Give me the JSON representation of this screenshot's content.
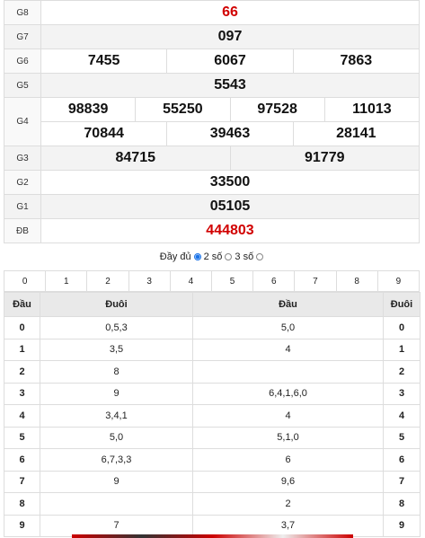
{
  "prizes": {
    "g8": {
      "label": "G8",
      "value": "66"
    },
    "g7": {
      "label": "G7",
      "value": "097"
    },
    "g6": {
      "label": "G6",
      "values": [
        "7455",
        "6067",
        "7863"
      ]
    },
    "g5": {
      "label": "G5",
      "value": "5543"
    },
    "g4": {
      "label": "G4",
      "row1": [
        "98839",
        "55250",
        "97528",
        "11013"
      ],
      "row2": [
        "70844",
        "39463",
        "28141"
      ]
    },
    "g3": {
      "label": "G3",
      "values": [
        "84715",
        "91779"
      ]
    },
    "g2": {
      "label": "G2",
      "value": "33500"
    },
    "g1": {
      "label": "G1",
      "value": "05105"
    },
    "db": {
      "label": "ĐB",
      "value": "444803"
    }
  },
  "options": {
    "full": "Đầy đủ",
    "two": "2 số",
    "three": "3 số",
    "selected": "full"
  },
  "digits": [
    "0",
    "1",
    "2",
    "3",
    "4",
    "5",
    "6",
    "7",
    "8",
    "9"
  ],
  "loto": {
    "headers": [
      "Đầu",
      "Đuôi",
      "Đầu",
      "Đuôi"
    ],
    "rows": [
      {
        "k": "0",
        "a": "0,5,3",
        "b": "5,0",
        "k2": "0"
      },
      {
        "k": "1",
        "a": "3,5",
        "b": "4",
        "k2": "1"
      },
      {
        "k": "2",
        "a": "8",
        "b": "",
        "k2": "2"
      },
      {
        "k": "3",
        "a": "9",
        "b": "6,4,1,6,0",
        "k2": "3"
      },
      {
        "k": "4",
        "a": "3,4,1",
        "b": "4",
        "k2": "4"
      },
      {
        "k": "5",
        "a": "5,0",
        "b": "5,1,0",
        "k2": "5"
      },
      {
        "k": "6",
        "a": "6,7,3,3",
        "b": "6",
        "k2": "6"
      },
      {
        "k": "7",
        "a": "9",
        "b": "9,6",
        "k2": "7"
      },
      {
        "k": "8",
        "a": "",
        "b": "2",
        "k2": "8"
      },
      {
        "k": "9",
        "a": "7",
        "b": "3,7",
        "k2": "9"
      }
    ]
  },
  "colors": {
    "accent_red": "#d10000",
    "radio_blue": "#1a73e8"
  }
}
